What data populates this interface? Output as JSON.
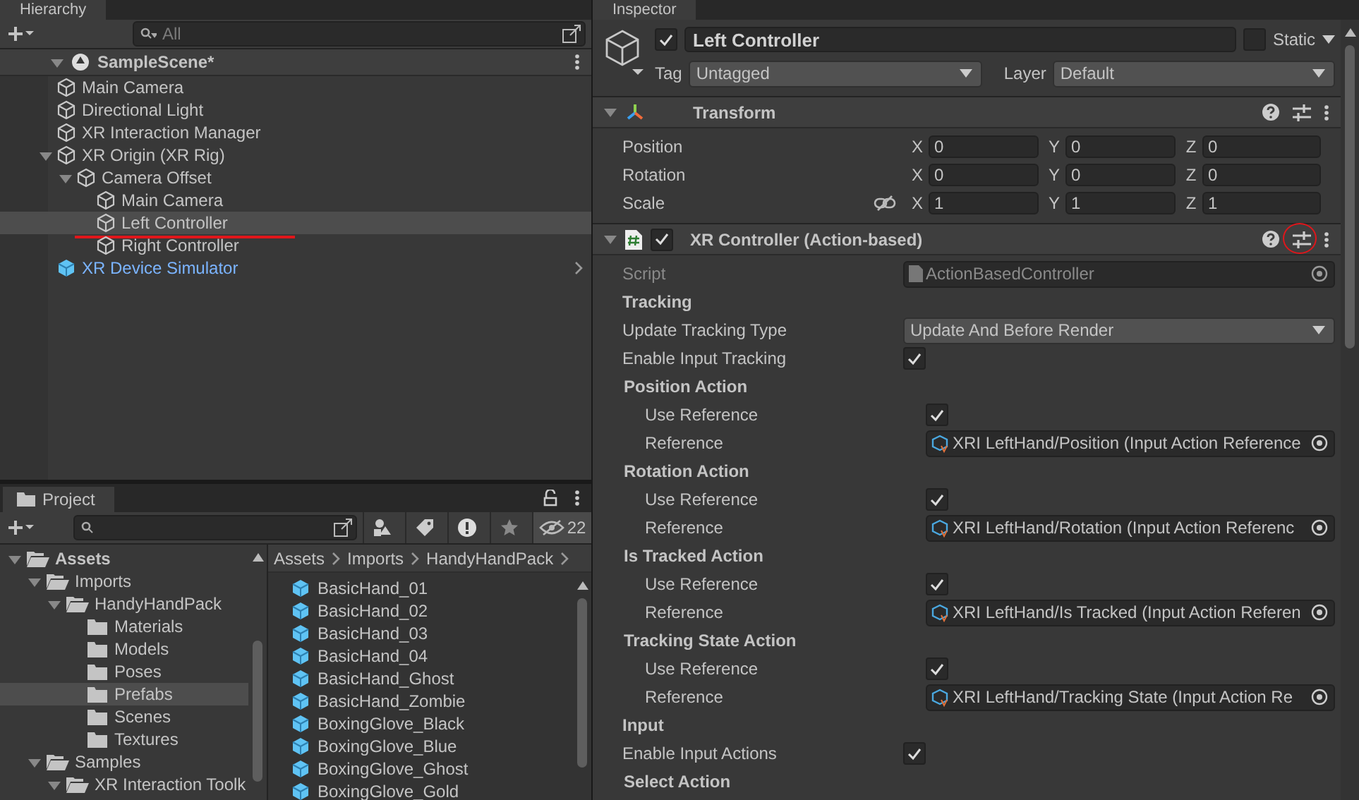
{
  "hierarchy": {
    "tab": "Hierarchy",
    "search": {
      "placeholder": "All"
    },
    "scene": {
      "name": "SampleScene*",
      "expanded": true
    },
    "items": [
      {
        "name": "Main Camera",
        "kind": "gameobject",
        "selected": false,
        "underlined": false
      },
      {
        "name": "Directional Light",
        "kind": "gameobject",
        "selected": false,
        "underlined": false
      },
      {
        "name": "XR Interaction Manager",
        "kind": "gameobject",
        "selected": false,
        "underlined": false
      },
      {
        "name": "XR Origin (XR Rig)",
        "kind": "gameobject",
        "selected": false,
        "underlined": false,
        "expanded": true,
        "children": [
          {
            "name": "Camera Offset",
            "kind": "gameobject",
            "selected": false,
            "underlined": false,
            "expanded": true,
            "children": [
              {
                "name": "Main Camera",
                "kind": "gameobject",
                "selected": false,
                "underlined": false
              },
              {
                "name": "Left Controller",
                "kind": "gameobject",
                "selected": true,
                "underlined": true
              },
              {
                "name": "Right Controller",
                "kind": "gameobject",
                "selected": false,
                "underlined": false
              }
            ]
          }
        ]
      },
      {
        "name": "XR Device Simulator",
        "kind": "prefab",
        "selected": false,
        "underlined": false
      }
    ]
  },
  "project": {
    "tab": "Project",
    "hidden_count": "22",
    "folders": [
      {
        "name": "Assets",
        "selected": false,
        "expanded": true,
        "children": [
          {
            "name": "Imports",
            "selected": false,
            "expanded": true,
            "children": [
              {
                "name": "HandyHandPack",
                "selected": false,
                "expanded": true,
                "children": [
                  {
                    "name": "Materials",
                    "selected": false
                  },
                  {
                    "name": "Models",
                    "selected": false
                  },
                  {
                    "name": "Poses",
                    "selected": false
                  },
                  {
                    "name": "Prefabs",
                    "selected": true
                  },
                  {
                    "name": "Scenes",
                    "selected": false
                  },
                  {
                    "name": "Textures",
                    "selected": false
                  }
                ]
              }
            ]
          },
          {
            "name": "Samples",
            "selected": false,
            "expanded": true,
            "children": [
              {
                "name": "XR Interaction Toolk",
                "selected": false,
                "expanded": true
              }
            ]
          }
        ]
      }
    ],
    "breadcrumb": [
      "Assets",
      "Imports",
      "HandyHandPack"
    ],
    "files": [
      "BasicHand_01",
      "BasicHand_02",
      "BasicHand_03",
      "BasicHand_04",
      "BasicHand_Ghost",
      "BasicHand_Zombie",
      "BoxingGlove_Black",
      "BoxingGlove_Blue",
      "BoxingGlove_Ghost",
      "BoxingGlove_Gold"
    ]
  },
  "inspector": {
    "tab": "Inspector",
    "object": {
      "active": true,
      "name": "Left Controller",
      "static": false,
      "tag_label": "Tag",
      "tag": "Untagged",
      "layer_label": "Layer",
      "layer": "Default",
      "static_label": "Static"
    },
    "components": [
      {
        "kind": "transform",
        "title": "Transform",
        "expanded": true,
        "preset_circled": false,
        "rows": [
          {
            "label": "Position",
            "fields": [
              {
                "axis": "X",
                "value": "0"
              },
              {
                "axis": "Y",
                "value": "0"
              },
              {
                "axis": "Z",
                "value": "0"
              }
            ]
          },
          {
            "label": "Rotation",
            "fields": [
              {
                "axis": "X",
                "value": "0"
              },
              {
                "axis": "Y",
                "value": "0"
              },
              {
                "axis": "Z",
                "value": "0"
              }
            ]
          },
          {
            "label": "Scale",
            "linked": false,
            "fields": [
              {
                "axis": "X",
                "value": "1"
              },
              {
                "axis": "Y",
                "value": "1"
              },
              {
                "axis": "Z",
                "value": "1"
              }
            ]
          }
        ]
      },
      {
        "kind": "script",
        "title": "XR Controller (Action-based)",
        "enabled": true,
        "expanded": true,
        "preset_circled": true,
        "properties": [
          {
            "kind": "script",
            "label": "Script",
            "value": "ActionBasedController"
          },
          {
            "kind": "section",
            "label": "Tracking"
          },
          {
            "kind": "dropdown",
            "label": "Update Tracking Type",
            "value": "Update And Before Render"
          },
          {
            "kind": "toggle",
            "label": "Enable Input Tracking",
            "checked": true
          },
          {
            "kind": "group",
            "label": "Position Action",
            "children": [
              {
                "kind": "toggle",
                "label": "Use Reference",
                "checked": true
              },
              {
                "kind": "reference",
                "label": "Reference",
                "value": "XRI LeftHand/Position (Input Action Reference"
              }
            ]
          },
          {
            "kind": "group",
            "label": "Rotation Action",
            "children": [
              {
                "kind": "toggle",
                "label": "Use Reference",
                "checked": true
              },
              {
                "kind": "reference",
                "label": "Reference",
                "value": "XRI LeftHand/Rotation (Input Action Referenc"
              }
            ]
          },
          {
            "kind": "group",
            "label": "Is Tracked Action",
            "children": [
              {
                "kind": "toggle",
                "label": "Use Reference",
                "checked": true
              },
              {
                "kind": "reference",
                "label": "Reference",
                "value": "XRI LeftHand/Is Tracked (Input Action Referen"
              }
            ]
          },
          {
            "kind": "group",
            "label": "Tracking State Action",
            "children": [
              {
                "kind": "toggle",
                "label": "Use Reference",
                "checked": true
              },
              {
                "kind": "reference",
                "label": "Reference",
                "value": "XRI LeftHand/Tracking State (Input Action Re"
              }
            ]
          },
          {
            "kind": "section",
            "label": "Input"
          },
          {
            "kind": "toggle",
            "label": "Enable Input Actions",
            "checked": true
          },
          {
            "kind": "group",
            "label": "Select Action"
          }
        ]
      }
    ]
  }
}
